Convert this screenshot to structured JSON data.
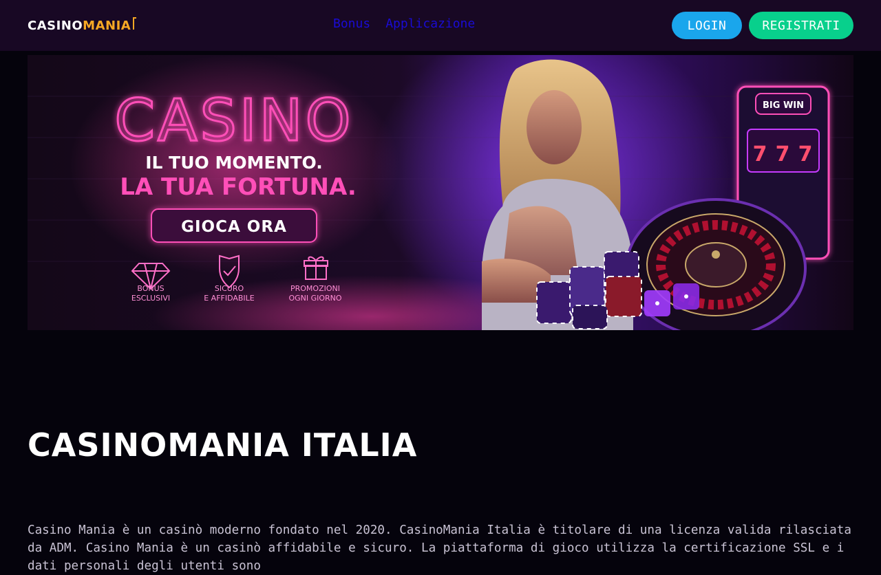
{
  "header": {
    "logo": {
      "part1": "CASINO",
      "part2": "MANIA"
    },
    "nav": [
      "Bonus",
      "Applicazione"
    ],
    "login_label": "LOGIN",
    "register_label": "REGISTRATI"
  },
  "banner": {
    "headline": "CASINO",
    "tagline1": "IL TUO MOMENTO.",
    "tagline2": "LA TUA FORTUNA.",
    "cta": "GIOCA ORA",
    "features": [
      {
        "line1": "BONUS",
        "line2": "ESCLUSIVI",
        "icon": "diamond-icon"
      },
      {
        "line1": "SICURO",
        "line2": "E AFFIDABILE",
        "icon": "shield-check-icon"
      },
      {
        "line1": "PROMOZIONI",
        "line2": "OGNI GIORNO",
        "icon": "gift-icon"
      }
    ],
    "slot_sign": "BIG WIN",
    "slot_reels": [
      "7",
      "7",
      "7"
    ]
  },
  "main": {
    "title": "CASINOMANIA ITALIA",
    "intro": "Casino Mania è un casinò moderno fondato nel 2020. CasinoMania Italia è titolare di una licenza valida rilasciata da ADM. Casino Mania è un casinò affidabile e sicuro. La piattaforma di gioco utilizza la certificazione SSL e i dati personali degli utenti sono"
  },
  "colors": {
    "header_bg": "#180824",
    "page_bg": "#05030c",
    "accent_orange": "#f7a824",
    "login_blue": "#1aa6ec",
    "register_green": "#08d08c",
    "nav_link": "#1a0bd4",
    "neon_pink": "#ff4fb8"
  }
}
